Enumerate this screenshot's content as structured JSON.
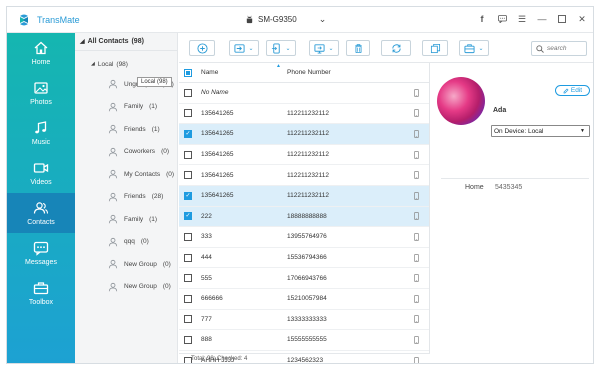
{
  "app": {
    "title": "TransMate",
    "device": "SM-G9350"
  },
  "colors": {
    "accent": "#1e9be0",
    "sidebar_top": "#15b6b0",
    "sidebar_bottom": "#1da1d3",
    "sidebar_active": "#1785b8",
    "row_selected": "#dbeefa"
  },
  "sidebar": {
    "items": [
      {
        "label": "Home",
        "icon": "home-icon"
      },
      {
        "label": "Photos",
        "icon": "photos-icon"
      },
      {
        "label": "Music",
        "icon": "music-icon"
      },
      {
        "label": "Videos",
        "icon": "videos-icon"
      },
      {
        "label": "Contacts",
        "icon": "contacts-icon",
        "active": true
      },
      {
        "label": "Messages",
        "icon": "messages-icon"
      },
      {
        "label": "Toolbox",
        "icon": "toolbox-icon"
      }
    ]
  },
  "tree": {
    "root_label": "All Contacts",
    "root_count": "(98)",
    "local_label": "Local",
    "local_count": "(98)",
    "tooltip": "Local  (98)",
    "groups": [
      {
        "label": "Ungrouped",
        "count": "(67)"
      },
      {
        "label": "Family",
        "count": "(1)"
      },
      {
        "label": "Friends",
        "count": "(1)"
      },
      {
        "label": "Coworkers",
        "count": "(0)"
      },
      {
        "label": "My Contacts",
        "count": "(0)"
      },
      {
        "label": "Friends",
        "count": "(28)"
      },
      {
        "label": "Family",
        "count": "(1)"
      },
      {
        "label": "qqq",
        "count": "(0)"
      },
      {
        "label": "New Group",
        "count": "(0)"
      },
      {
        "label": "New Group",
        "count": "(0)"
      }
    ]
  },
  "toolbar": {
    "search_placeholder": "search"
  },
  "table": {
    "header_name": "Name",
    "header_phone": "Phone Number",
    "rows": [
      {
        "name": "No Name",
        "phone": "",
        "checked": false,
        "italic": true
      },
      {
        "name": "135641265",
        "phone": "112211232112",
        "checked": false
      },
      {
        "name": "135641265",
        "phone": "112211232112",
        "checked": true
      },
      {
        "name": "135641265",
        "phone": "112211232112",
        "checked": false
      },
      {
        "name": "135641265",
        "phone": "112211232112",
        "checked": false
      },
      {
        "name": "135641265",
        "phone": "112211232112",
        "checked": true
      },
      {
        "name": "222",
        "phone": "18888888888",
        "checked": true
      },
      {
        "name": "333",
        "phone": "13955764976",
        "checked": false
      },
      {
        "name": "444",
        "phone": "15536794366",
        "checked": false
      },
      {
        "name": "555",
        "phone": "17066943766",
        "checked": false
      },
      {
        "name": "666666",
        "phone": "15210057984",
        "checked": false
      },
      {
        "name": "777",
        "phone": "13333333333",
        "checked": false
      },
      {
        "name": "888",
        "phone": "15555555555",
        "checked": false
      },
      {
        "name": "AHHH JJJJ",
        "phone": "1234562323",
        "checked": false
      }
    ],
    "footer": "Total: 98; Checked: 4"
  },
  "detail": {
    "edit_label": "Edit",
    "contact_name": "Ada",
    "location_select": "On Device: Local",
    "fields": [
      {
        "label": "Home",
        "value": "5435345"
      }
    ]
  }
}
